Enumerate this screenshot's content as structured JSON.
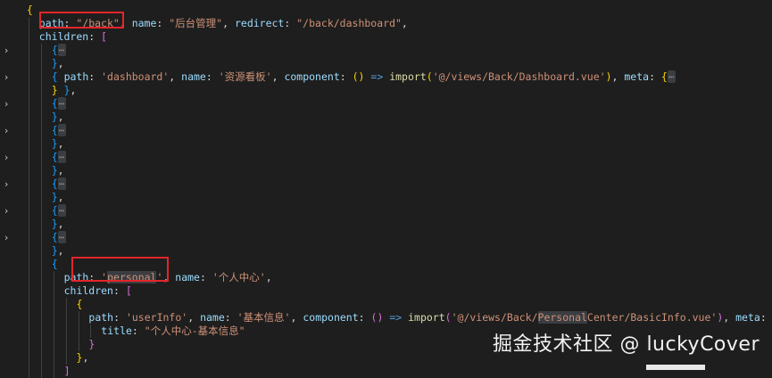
{
  "code_lines": [
    {
      "indent": 2,
      "fold": false,
      "tokens": [
        [
          "b1",
          "{"
        ]
      ]
    },
    {
      "indent": 4,
      "fold": false,
      "tokens": [
        [
          "key",
          "path"
        ],
        [
          "plain",
          ": "
        ],
        [
          "str",
          "\"/back\""
        ],
        [
          "plain",
          ", "
        ],
        [
          "key",
          "name"
        ],
        [
          "plain",
          ": "
        ],
        [
          "str",
          "\"后台管理\""
        ],
        [
          "plain",
          ", "
        ],
        [
          "key",
          "redirect"
        ],
        [
          "plain",
          ": "
        ],
        [
          "str",
          "\"/back/dashboard\""
        ],
        [
          "plain",
          ","
        ]
      ]
    },
    {
      "indent": 4,
      "fold": false,
      "tokens": [
        [
          "key",
          "children"
        ],
        [
          "plain",
          ": "
        ],
        [
          "b2",
          "["
        ]
      ]
    },
    {
      "indent": 6,
      "fold": true,
      "tokens": [
        [
          "b3",
          "{"
        ],
        [
          "fold",
          "⋯"
        ]
      ]
    },
    {
      "indent": 6,
      "fold": false,
      "tokens": [
        [
          "b3",
          "}"
        ],
        [
          "plain",
          ","
        ]
      ]
    },
    {
      "indent": 6,
      "fold": true,
      "tokens": [
        [
          "b3",
          "{"
        ],
        [
          "plain",
          " "
        ],
        [
          "key",
          "path"
        ],
        [
          "plain",
          ": "
        ],
        [
          "str",
          "'dashboard'"
        ],
        [
          "plain",
          ", "
        ],
        [
          "key",
          "name"
        ],
        [
          "plain",
          ": "
        ],
        [
          "str",
          "'资源看板'"
        ],
        [
          "plain",
          ", "
        ],
        [
          "key",
          "component"
        ],
        [
          "plain",
          ": "
        ],
        [
          "b1",
          "()"
        ],
        [
          "plain",
          " "
        ],
        [
          "op",
          "=>"
        ],
        [
          "plain",
          " "
        ],
        [
          "fn",
          "import"
        ],
        [
          "b1",
          "("
        ],
        [
          "str",
          "'@/views/Back/Dashboard.vue'"
        ],
        [
          "b1",
          ")"
        ],
        [
          "plain",
          ", "
        ],
        [
          "key",
          "meta"
        ],
        [
          "plain",
          ": "
        ],
        [
          "b1",
          "{"
        ],
        [
          "fold",
          "⋯"
        ]
      ]
    },
    {
      "indent": 6,
      "fold": false,
      "tokens": [
        [
          "b1",
          "}"
        ],
        [
          "plain",
          " "
        ],
        [
          "b3",
          "}"
        ],
        [
          "plain",
          ","
        ]
      ]
    },
    {
      "indent": 6,
      "fold": true,
      "tokens": [
        [
          "b3",
          "{"
        ],
        [
          "fold",
          "⋯"
        ]
      ]
    },
    {
      "indent": 6,
      "fold": false,
      "tokens": [
        [
          "b3",
          "}"
        ],
        [
          "plain",
          ","
        ]
      ]
    },
    {
      "indent": 6,
      "fold": true,
      "tokens": [
        [
          "b3",
          "{"
        ],
        [
          "fold",
          "⋯"
        ]
      ]
    },
    {
      "indent": 6,
      "fold": false,
      "tokens": [
        [
          "b3",
          "}"
        ],
        [
          "plain",
          ","
        ]
      ]
    },
    {
      "indent": 6,
      "fold": true,
      "tokens": [
        [
          "b3",
          "{"
        ],
        [
          "fold",
          "⋯"
        ]
      ]
    },
    {
      "indent": 6,
      "fold": false,
      "tokens": [
        [
          "b3",
          "}"
        ],
        [
          "plain",
          ","
        ]
      ]
    },
    {
      "indent": 6,
      "fold": true,
      "tokens": [
        [
          "b3",
          "{"
        ],
        [
          "fold",
          "⋯"
        ]
      ]
    },
    {
      "indent": 6,
      "fold": false,
      "tokens": [
        [
          "b3",
          "}"
        ],
        [
          "plain",
          ","
        ]
      ]
    },
    {
      "indent": 6,
      "fold": true,
      "tokens": [
        [
          "b3",
          "{"
        ],
        [
          "fold",
          "⋯"
        ]
      ]
    },
    {
      "indent": 6,
      "fold": false,
      "tokens": [
        [
          "b3",
          "}"
        ],
        [
          "plain",
          ","
        ]
      ]
    },
    {
      "indent": 6,
      "fold": true,
      "tokens": [
        [
          "b3",
          "{"
        ],
        [
          "fold",
          "⋯"
        ]
      ]
    },
    {
      "indent": 6,
      "fold": false,
      "tokens": [
        [
          "b3",
          "}"
        ],
        [
          "plain",
          ","
        ]
      ]
    },
    {
      "indent": 6,
      "fold": false,
      "tokens": [
        [
          "b3",
          "{"
        ]
      ]
    },
    {
      "indent": 8,
      "fold": false,
      "tokens": [
        [
          "key",
          "path"
        ],
        [
          "plain",
          ": "
        ],
        [
          "str",
          "'"
        ],
        [
          "strhl",
          "personal"
        ],
        [
          "str",
          "'"
        ],
        [
          "plain",
          ", "
        ],
        [
          "key",
          "name"
        ],
        [
          "plain",
          ": "
        ],
        [
          "str",
          "'个人中心'"
        ],
        [
          "plain",
          ","
        ]
      ]
    },
    {
      "indent": 8,
      "fold": false,
      "tokens": [
        [
          "key",
          "children"
        ],
        [
          "plain",
          ": "
        ],
        [
          "b2",
          "["
        ]
      ]
    },
    {
      "indent": 10,
      "fold": false,
      "tokens": [
        [
          "b1",
          "{"
        ]
      ]
    },
    {
      "indent": 12,
      "fold": false,
      "tokens": [
        [
          "key",
          "path"
        ],
        [
          "plain",
          ": "
        ],
        [
          "str",
          "'userInfo'"
        ],
        [
          "plain",
          ", "
        ],
        [
          "key",
          "name"
        ],
        [
          "plain",
          ": "
        ],
        [
          "str",
          "'基本信息'"
        ],
        [
          "plain",
          ", "
        ],
        [
          "key",
          "component"
        ],
        [
          "plain",
          ": "
        ],
        [
          "b2",
          "()"
        ],
        [
          "plain",
          " "
        ],
        [
          "op",
          "=>"
        ],
        [
          "plain",
          " "
        ],
        [
          "fn",
          "import"
        ],
        [
          "b2",
          "("
        ],
        [
          "str",
          "'@/views/Back/"
        ],
        [
          "strhl",
          "Personal"
        ],
        [
          "str",
          "Center/BasicInfo.vue'"
        ],
        [
          "b2",
          ")"
        ],
        [
          "plain",
          ", "
        ],
        [
          "key",
          "meta"
        ],
        [
          "plain",
          ": "
        ],
        [
          "b2",
          "{"
        ]
      ]
    },
    {
      "indent": 14,
      "fold": false,
      "tokens": [
        [
          "key",
          "title"
        ],
        [
          "plain",
          ": "
        ],
        [
          "str",
          "\"个人中心-基本信息\""
        ]
      ]
    },
    {
      "indent": 12,
      "fold": false,
      "tokens": [
        [
          "b2",
          "}"
        ]
      ]
    },
    {
      "indent": 10,
      "fold": false,
      "tokens": [
        [
          "b1",
          "}"
        ],
        [
          "plain",
          ","
        ]
      ]
    },
    {
      "indent": 8,
      "fold": false,
      "tokens": [
        [
          "b2",
          "]"
        ]
      ]
    }
  ],
  "gutter_icon": "chevron-right-icon",
  "watermark": "掘金技术社区 @ luckyCover"
}
